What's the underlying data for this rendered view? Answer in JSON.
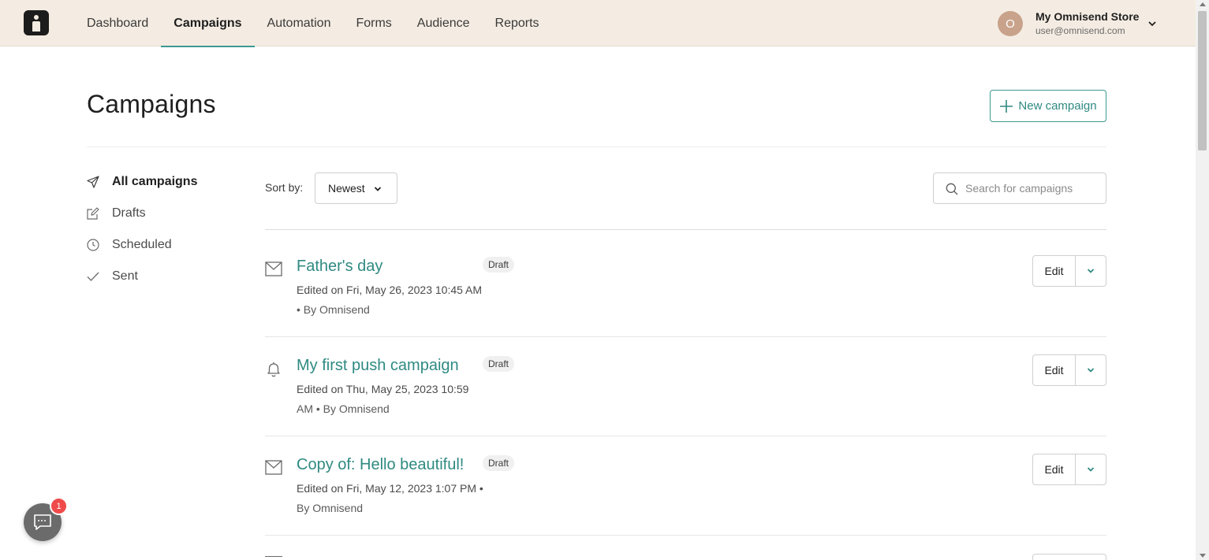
{
  "topnav": {
    "items": [
      {
        "label": "Dashboard",
        "active": false
      },
      {
        "label": "Campaigns",
        "active": true
      },
      {
        "label": "Automation",
        "active": false
      },
      {
        "label": "Forms",
        "active": false
      },
      {
        "label": "Audience",
        "active": false
      },
      {
        "label": "Reports",
        "active": false
      }
    ],
    "account": {
      "avatar_letter": "O",
      "store_name": "My Omnisend Store",
      "email": "user@omnisend.com"
    }
  },
  "page": {
    "title": "Campaigns",
    "new_campaign_label": "New campaign"
  },
  "sidebar": {
    "items": [
      {
        "label": "All campaigns",
        "icon": "paper-plane-icon",
        "active": true
      },
      {
        "label": "Drafts",
        "icon": "pencil-edit-icon",
        "active": false
      },
      {
        "label": "Scheduled",
        "icon": "clock-icon",
        "active": false
      },
      {
        "label": "Sent",
        "icon": "checkmark-icon",
        "active": false
      }
    ]
  },
  "toolbar": {
    "sort_label": "Sort by:",
    "sort_value": "Newest",
    "search_placeholder": "Search for campaigns"
  },
  "campaigns": [
    {
      "title": "Father's day",
      "type_icon": "envelope-icon",
      "status": "Draft",
      "meta_line1": "Edited on Fri, May 26, 2023 10:45 AM",
      "meta_line2": "• By Omnisend",
      "edit_label": "Edit"
    },
    {
      "title": "My first push campaign",
      "type_icon": "bell-icon",
      "status": "Draft",
      "meta_line1": "Edited on Thu, May 25, 2023 10:59",
      "meta_line2": "AM • By Omnisend",
      "edit_label": "Edit"
    },
    {
      "title": "Copy of: Hello beautiful!",
      "type_icon": "envelope-icon",
      "status": "Draft",
      "meta_line1": "Edited on Fri, May 12, 2023 1:07 PM •",
      "meta_line2": "By Omnisend",
      "edit_label": "Edit"
    }
  ],
  "chat": {
    "badge_count": "1"
  },
  "colors": {
    "accent": "#3b9a92",
    "topbar_bg": "#f4ece2",
    "badge_red": "#ef4b4b"
  }
}
